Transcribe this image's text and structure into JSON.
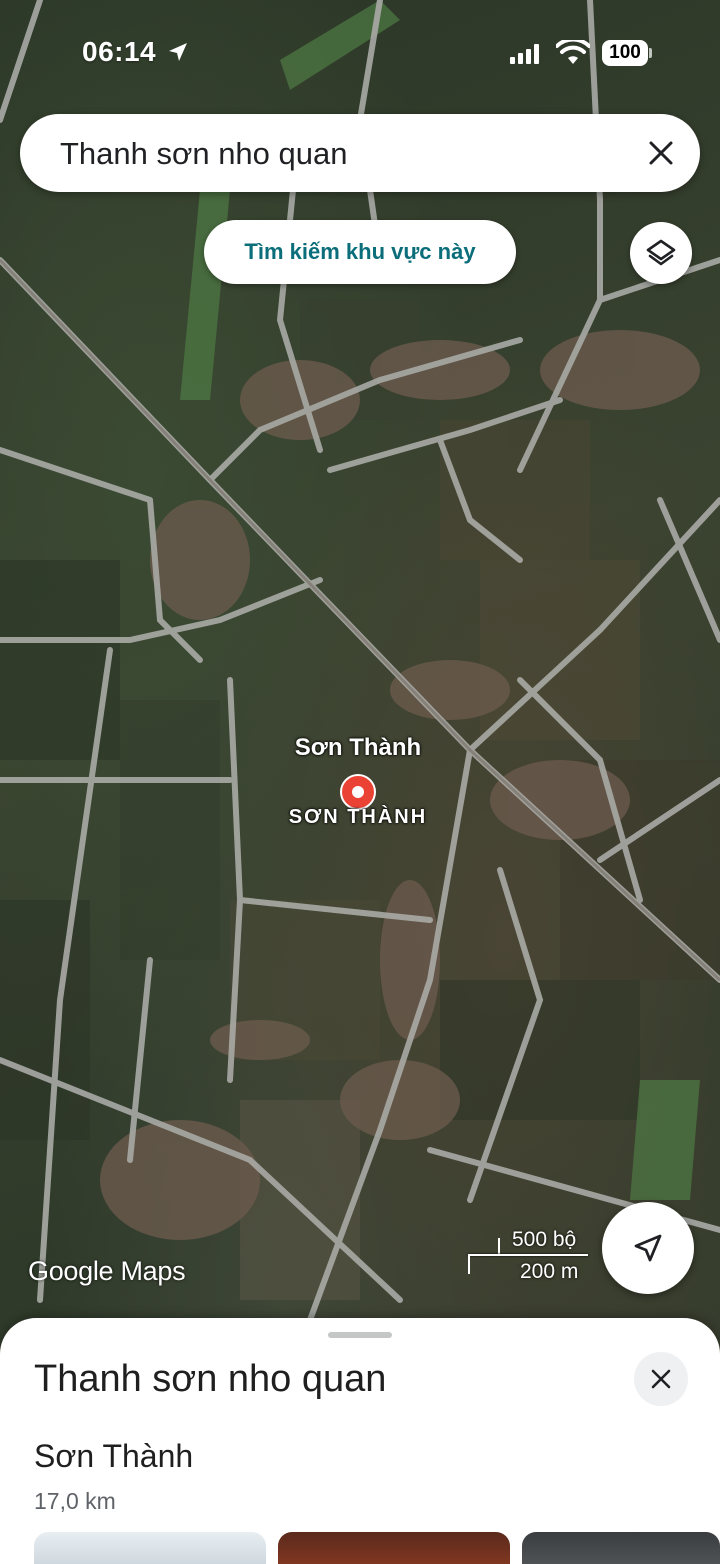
{
  "status_bar": {
    "time": "06:14",
    "battery": "100"
  },
  "search": {
    "query": "Thanh sơn nho quan"
  },
  "map": {
    "search_area_label": "Tìm kiếm khu vực này",
    "place_label": "Sơn Thành",
    "place_label_upper": "SƠN THÀNH",
    "logo": "Google Maps",
    "scale_imperial": "500 bộ",
    "scale_metric": "200 m",
    "pin_color": "#ea4335"
  },
  "sheet": {
    "title": "Thanh sơn nho quan",
    "result_name": "Sơn Thành",
    "result_distance": "17,0 km"
  }
}
